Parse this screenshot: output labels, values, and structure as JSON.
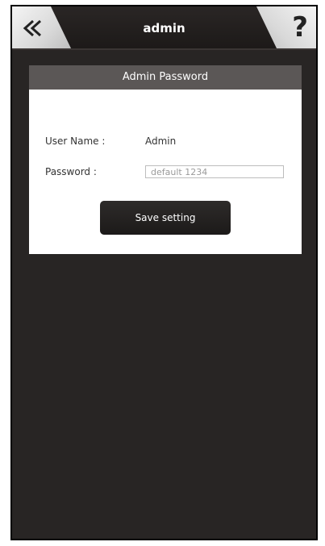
{
  "header": {
    "title": "admin",
    "back_icon": "double-chevron-left-icon",
    "help_label": "?"
  },
  "panel": {
    "title": "Admin Password",
    "username_label": "User Name :",
    "username_value": "Admin",
    "password_label": "Password :",
    "password_placeholder": "default 1234",
    "save_label": "Save setting"
  },
  "colors": {
    "background": "#282524",
    "header_bar": "#5b5756",
    "card": "#ffffff",
    "button": "#1f1c1b"
  }
}
